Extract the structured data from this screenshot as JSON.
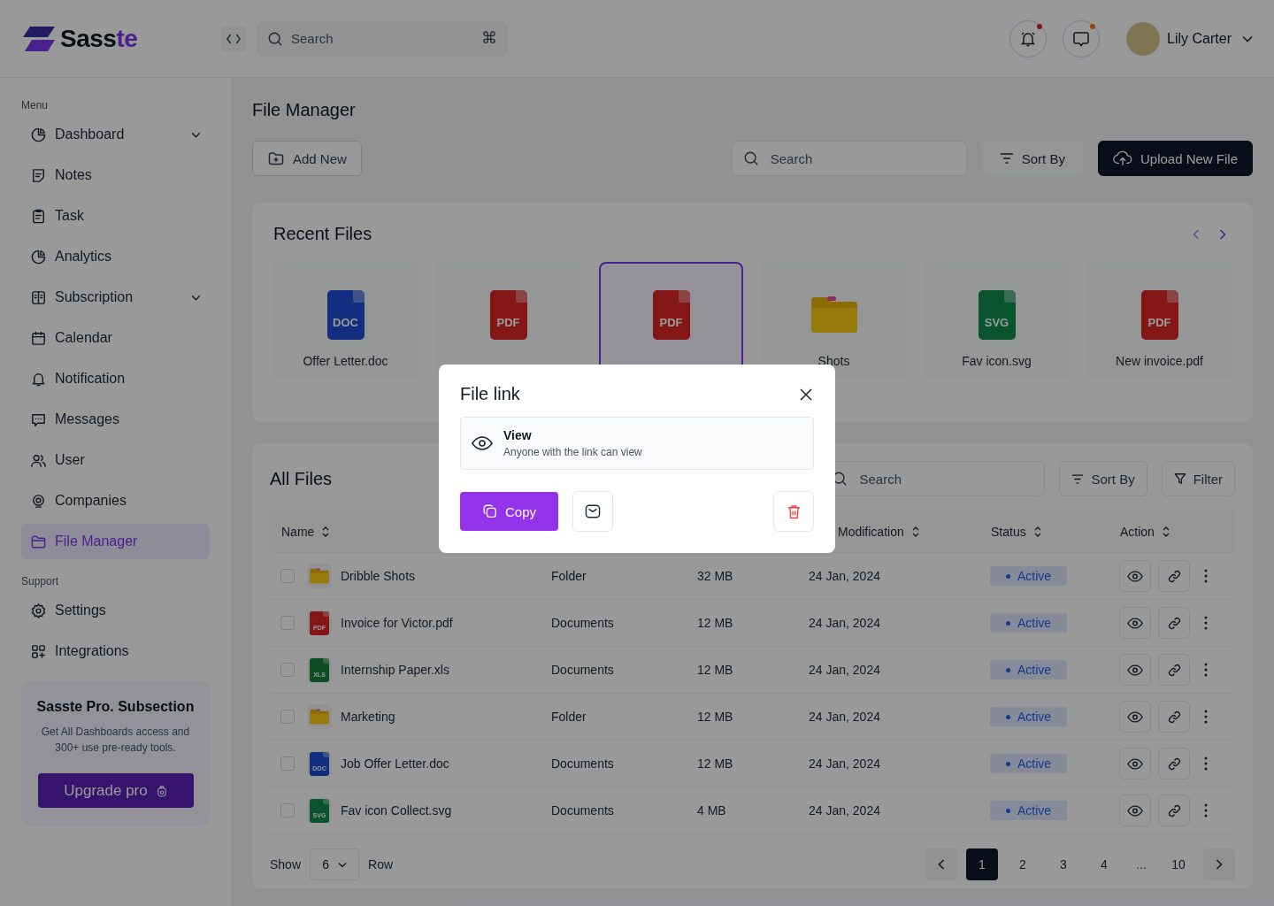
{
  "logo": {
    "main": "Sass",
    "accent": "te"
  },
  "topbar": {
    "search": {
      "placeholder": "Search",
      "shortcut": "⌘"
    },
    "alerts": [
      {
        "kind": "bell",
        "color": "#841717"
      },
      {
        "kind": "chat",
        "color": "#95450d"
      }
    ],
    "user": {
      "name": "Lily Carter"
    }
  },
  "sidebar": {
    "sections": [
      {
        "title": "Menu",
        "items": [
          {
            "label": "Dashboard",
            "kind": "dashboard",
            "expandable": true,
            "selected": false
          },
          {
            "label": "Notes",
            "kind": "notes",
            "expandable": false,
            "selected": false
          },
          {
            "label": "Task",
            "kind": "task",
            "expandable": false,
            "selected": false
          },
          {
            "label": "Analytics",
            "kind": "analytics",
            "expandable": false,
            "selected": false
          },
          {
            "label": "Subscription",
            "kind": "subscription",
            "expandable": true,
            "selected": false
          },
          {
            "label": "Calendar",
            "kind": "calendar",
            "expandable": false,
            "selected": false
          },
          {
            "label": "Notification",
            "kind": "notification",
            "expandable": false,
            "selected": false
          },
          {
            "label": "Messages",
            "kind": "messages",
            "expandable": false,
            "selected": false
          },
          {
            "label": "User",
            "kind": "user",
            "expandable": false,
            "selected": false
          },
          {
            "label": "Companies",
            "kind": "companies",
            "expandable": false,
            "selected": false
          },
          {
            "label": "File Manager",
            "kind": "files",
            "expandable": false,
            "selected": true
          }
        ]
      },
      {
        "title": "Support",
        "items": [
          {
            "label": "Settings",
            "kind": "settings",
            "expandable": false,
            "selected": false
          },
          {
            "label": "Integrations",
            "kind": "integrations",
            "expandable": false,
            "selected": false
          }
        ]
      }
    ],
    "promo": {
      "title": "Sasste Pro. Subsection",
      "text": "Get All Dashboards access and 300+ use pre-ready tools.",
      "button": "Upgrade pro"
    }
  },
  "page": {
    "title": "File Manager",
    "add_button": "Add New",
    "search": {
      "placeholder": "Search"
    },
    "sort_button": "Sort By",
    "upload_button": "Upload New File"
  },
  "recent": {
    "title": "Recent Files",
    "files": [
      {
        "kind": "doc",
        "badge": "DOC",
        "name": "Offer Letter.doc",
        "selected": false
      },
      {
        "kind": "pdf",
        "badge": "PDF",
        "selected": false
      },
      {
        "kind": "pdf",
        "badge": "PDF",
        "selected": true
      },
      {
        "kind": "folder",
        "name": "Shots",
        "selected": false
      },
      {
        "kind": "svg",
        "badge": "SVG",
        "name": "Fav icon.svg",
        "selected": false
      },
      {
        "kind": "pdf",
        "badge": "PDF",
        "name": "New invoice.pdf",
        "selected": false
      }
    ]
  },
  "all_files": {
    "title": "All Files",
    "search": {
      "placeholder": "Search"
    },
    "sort_button": "Sort By",
    "filter_button": "Filter",
    "columns": [
      {
        "label": "Name",
        "sortable": true
      },
      {
        "label": "Modification",
        "sortable": true
      },
      {
        "label": "Status",
        "sortable": true
      },
      {
        "label": "Action",
        "sortable": true
      }
    ],
    "rows": [
      {
        "checked": false,
        "kind": "folder",
        "name": "Dribble Shots",
        "type": "Folder",
        "size": "32 MB",
        "date": "24 Jan, 2024",
        "status": "Active"
      },
      {
        "checked": false,
        "kind": "pdf",
        "badge": "PDF",
        "name": "Invoice for Victor.pdf",
        "type": "Documents",
        "size": "12 MB",
        "date": "24 Jan, 2024",
        "status": "Active"
      },
      {
        "checked": false,
        "kind": "xls",
        "badge": "XLS",
        "name": "Internship Paper.xls",
        "type": "Documents",
        "size": "12 MB",
        "date": "24 Jan, 2024",
        "status": "Active"
      },
      {
        "checked": false,
        "kind": "folder",
        "name": "Marketing",
        "type": "Folder",
        "size": "12 MB",
        "date": "24 Jan, 2024",
        "status": "Active"
      },
      {
        "checked": false,
        "kind": "doc",
        "badge": "DOC",
        "name": "Job Offer Letter.doc",
        "type": "Documents",
        "size": "12 MB",
        "date": "24 Jan, 2024",
        "status": "Active"
      },
      {
        "checked": false,
        "kind": "svg",
        "badge": "SVG",
        "name": "Fav icon Collect.svg",
        "type": "Documents",
        "size": "4 MB",
        "date": "24 Jan, 2024",
        "status": "Active"
      }
    ],
    "footer": {
      "show_label": "Show",
      "rows_value": "6",
      "row_label": "Row"
    },
    "pages": [
      {
        "kind": "page",
        "label": "1",
        "selected": true
      },
      {
        "kind": "page",
        "label": "2",
        "selected": false
      },
      {
        "kind": "page",
        "label": "3",
        "selected": false
      },
      {
        "kind": "page",
        "label": "4",
        "selected": false
      },
      {
        "kind": "gap",
        "label": "...",
        "selected": false
      },
      {
        "kind": "page",
        "label": "10",
        "selected": false
      }
    ]
  },
  "modal": {
    "title": "File link",
    "option": {
      "title": "View",
      "description": "Anyone with the link can view"
    },
    "copy_button": "Copy"
  }
}
